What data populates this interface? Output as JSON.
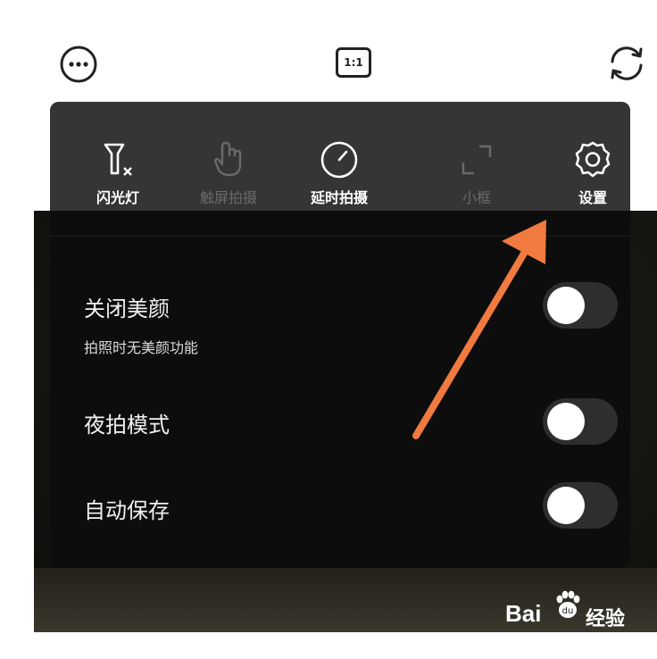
{
  "top_bar": {
    "more_icon": "more-horizontal-icon",
    "ratio_label": "1:1",
    "switch_camera_icon": "switch-camera-icon"
  },
  "toolbar": {
    "items": [
      {
        "label": "闪光灯",
        "icon": "flash-off-icon",
        "enabled": true
      },
      {
        "label": "触屏拍摄",
        "icon": "touch-capture-icon",
        "enabled": false
      },
      {
        "label": "延时拍摄",
        "icon": "timer-icon",
        "enabled": true
      },
      {
        "label": "小框",
        "icon": "frame-icon",
        "enabled": false
      },
      {
        "label": "设置",
        "icon": "gear-icon",
        "enabled": true
      }
    ]
  },
  "settings": {
    "rows": [
      {
        "title": "关闭美颜",
        "subtitle": "拍照时无美颜功能",
        "toggle_on": false
      },
      {
        "title": "夜拍模式",
        "toggle_on": false
      },
      {
        "title": "自动保存",
        "toggle_on": false
      }
    ]
  },
  "annotation": {
    "arrow_color": "#f07a3f"
  },
  "watermark": {
    "logo_text": "Bai",
    "logo_text_2": "经验",
    "url": "jingyan.baidu.com"
  },
  "colors": {
    "panel_bg": "#0d0d0d",
    "toolbar_bg": "#353535",
    "toggle_track": "#2e2e2e",
    "toggle_knob": "#ffffff"
  }
}
